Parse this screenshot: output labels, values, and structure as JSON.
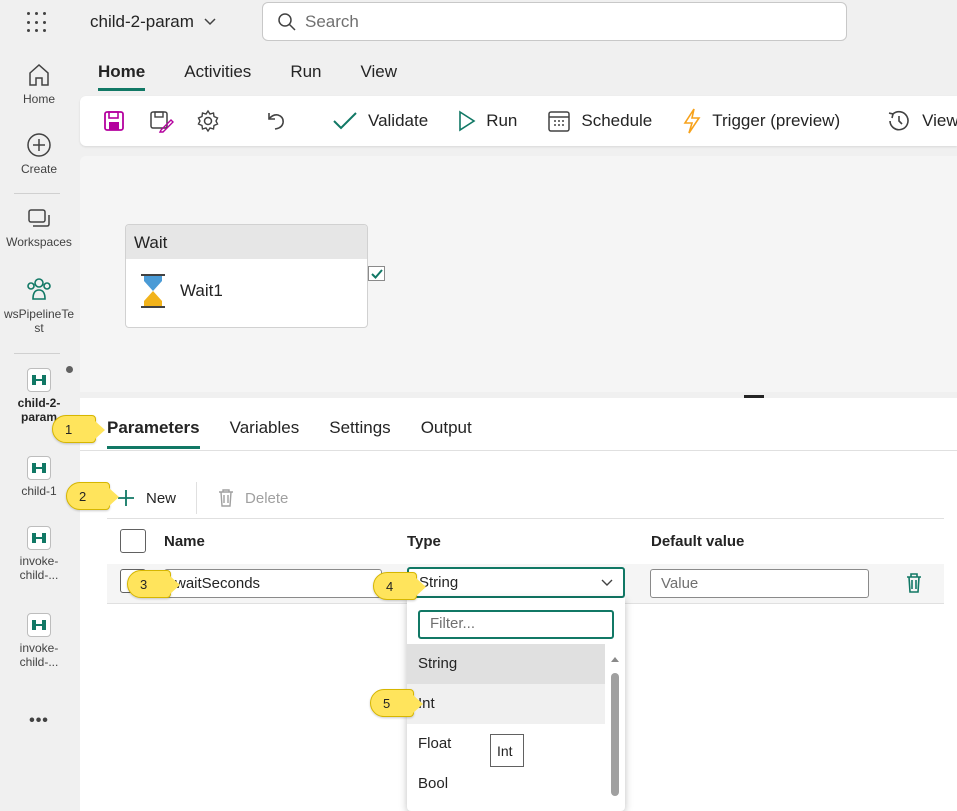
{
  "app": {
    "title": "child-2-param"
  },
  "search": {
    "placeholder": "Search"
  },
  "rail": {
    "home": "Home",
    "create": "Create",
    "workspaces": "Workspaces",
    "workspace_line1": "wsPipelineTe",
    "workspace_line2": "st",
    "items": [
      {
        "line1": "child-2-",
        "line2": "param"
      },
      {
        "line1": "child-1",
        "line2": ""
      },
      {
        "line1": "invoke-",
        "line2": "child-..."
      },
      {
        "line1": "invoke-",
        "line2": "child-..."
      }
    ],
    "more": "•••"
  },
  "menu": {
    "tabs": [
      "Home",
      "Activities",
      "Run",
      "View"
    ],
    "active": "Home"
  },
  "toolbar": {
    "validate": "Validate",
    "run": "Run",
    "schedule": "Schedule",
    "trigger": "Trigger (preview)",
    "view": "View"
  },
  "canvas": {
    "activity_type": "Wait",
    "activity_name": "Wait1"
  },
  "panel": {
    "tabs": [
      "Parameters",
      "Variables",
      "Settings",
      "Output"
    ],
    "active_tab": "Parameters",
    "new_label": "New",
    "delete_label": "Delete",
    "columns": {
      "name": "Name",
      "type": "Type",
      "default": "Default value"
    },
    "row": {
      "name": "waitSeconds",
      "type": "String",
      "default_placeholder": "Value"
    }
  },
  "dropdown": {
    "filter_placeholder": "Filter...",
    "options": [
      "String",
      "Int",
      "Float",
      "Bool"
    ],
    "selected": "String",
    "hovered": "Int",
    "tooltip": "Int"
  },
  "callouts": [
    "1",
    "2",
    "3",
    "4",
    "5"
  ],
  "colors": {
    "accent": "#117865",
    "callout": "#ffe45c",
    "save_icon": "#b4009e",
    "trigger_icon": "#f7a21b"
  }
}
